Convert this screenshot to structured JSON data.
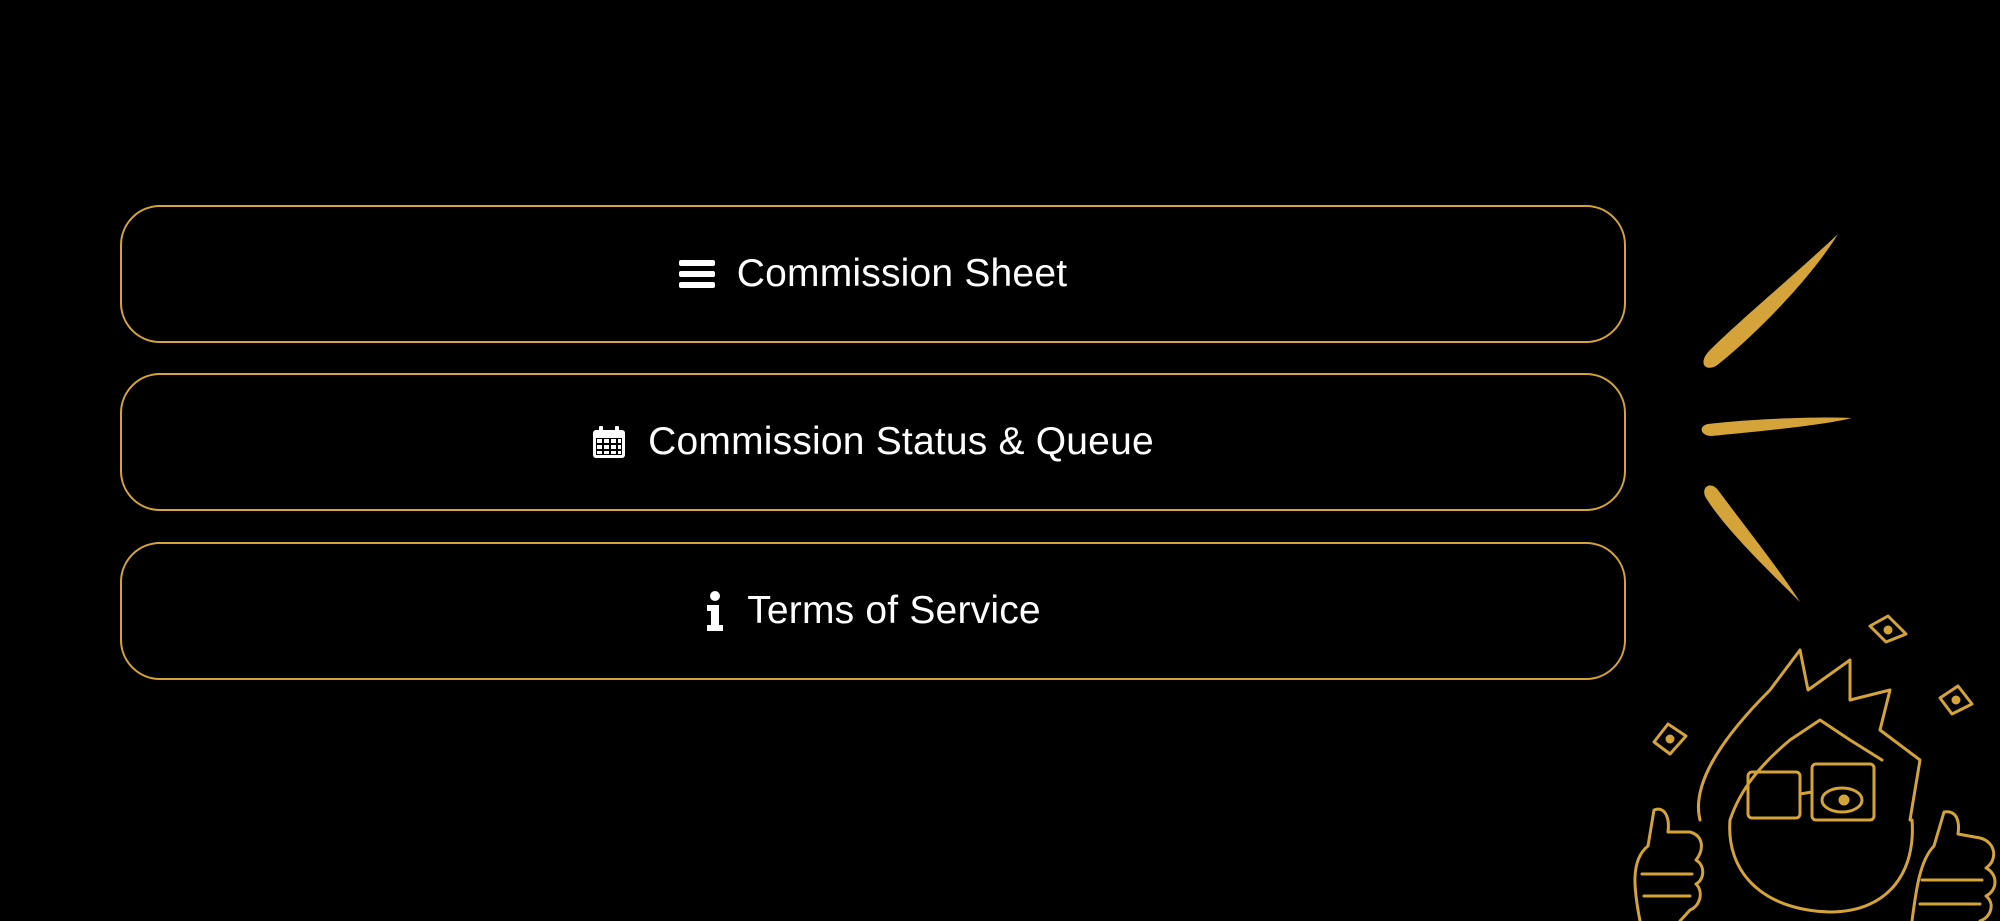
{
  "links": [
    {
      "label": "Commission Sheet",
      "icon": "list-icon"
    },
    {
      "label": "Commission Status & Queue",
      "icon": "calendar-icon"
    },
    {
      "label": "Terms of Service",
      "icon": "info-icon"
    }
  ],
  "colors": {
    "background": "#000000",
    "accent": "#d4a43a",
    "text": "#ffffff"
  }
}
